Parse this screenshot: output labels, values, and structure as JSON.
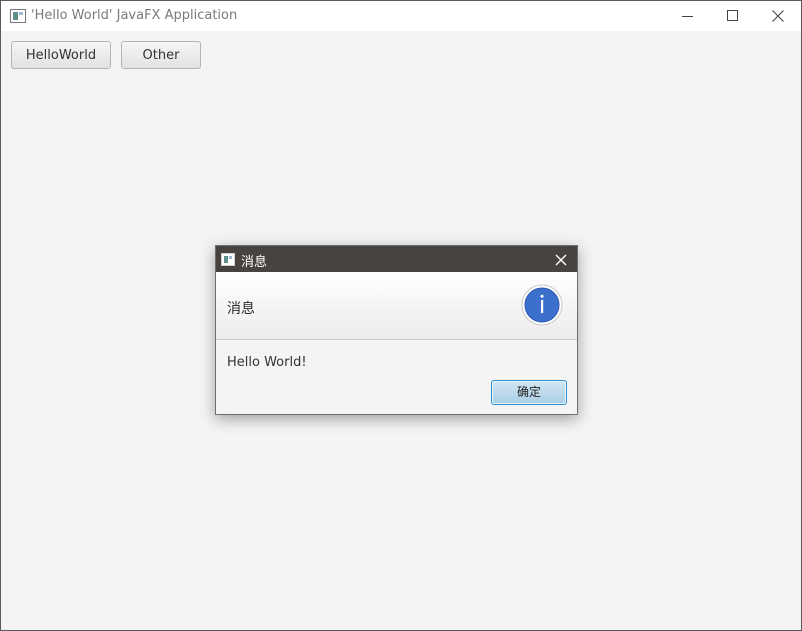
{
  "window": {
    "title": "'Hello World' JavaFX Application",
    "controls": {
      "minimize_icon": "minimize-icon",
      "maximize_icon": "maximize-icon",
      "close_icon": "close-icon"
    }
  },
  "toolbar": {
    "helloworld_label": "HelloWorld",
    "other_label": "Other"
  },
  "dialog": {
    "title": "消息",
    "header_text": "消息",
    "content_text": "Hello World!",
    "ok_label": "确定",
    "icon": "info-icon",
    "colors": {
      "titlebar": "#48433f",
      "info_icon": "#3d6fcd",
      "ok_border": "#2d92cf"
    }
  }
}
